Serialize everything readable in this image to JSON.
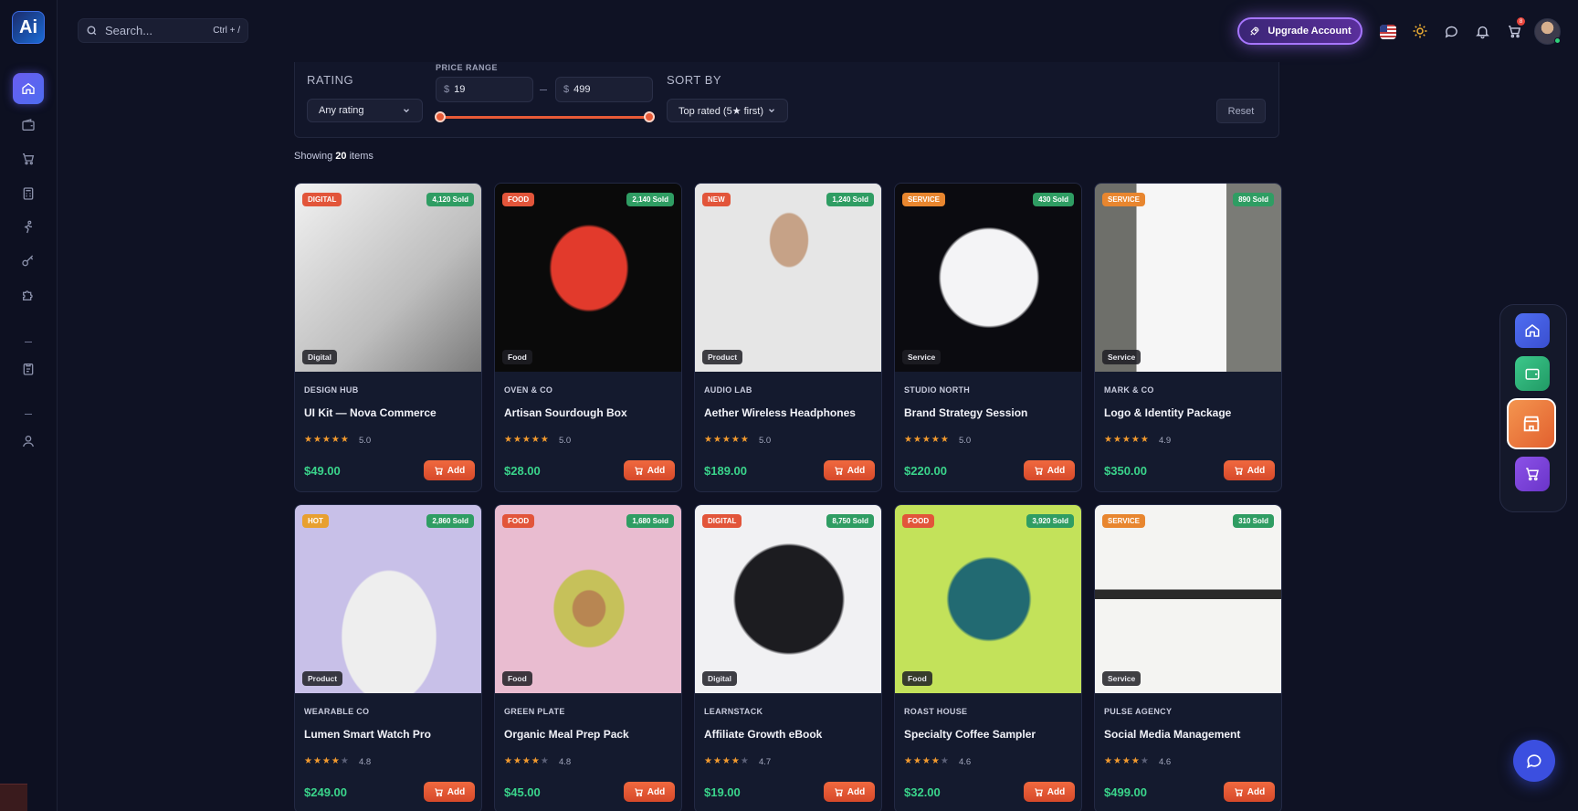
{
  "app": {
    "logo_text": "Ai"
  },
  "search": {
    "placeholder": "Search...",
    "shortcut": "Ctrl + /"
  },
  "header": {
    "upgrade_label": "Upgrade Account",
    "cart_count": "8"
  },
  "filters": {
    "rating_label": "RATING",
    "rating_value": "Any rating",
    "price_label": "PRICE RANGE",
    "currency": "$",
    "price_min": "19",
    "price_max": "499",
    "sort_label": "SORT BY",
    "sort_value": "Top rated (5★ first)",
    "reset_label": "Reset"
  },
  "results": {
    "prefix": "Showing",
    "count": "20",
    "suffix": "items"
  },
  "add_label": "Add",
  "products": [
    {
      "badge": "DIGITAL",
      "badge_color": "#e2553a",
      "sold": "4,120 Sold",
      "category": "Digital",
      "vendor": "DESIGN HUB",
      "name": "UI Kit — Nova Commerce",
      "rating": "5.0",
      "stars": 5,
      "price": "$49.00",
      "image": "camera"
    },
    {
      "badge": "FOOD",
      "badge_color": "#e2553a",
      "sold": "2,140 Sold",
      "category": "Food",
      "vendor": "OVEN & CO",
      "name": "Artisan Sourdough Box",
      "rating": "5.0",
      "stars": 5,
      "price": "$28.00",
      "image": "red-sneakers"
    },
    {
      "badge": "NEW",
      "badge_color": "#e2553a",
      "sold": "1,240 Sold",
      "category": "Product",
      "vendor": "AUDIO LAB",
      "name": "Aether Wireless Headphones",
      "rating": "5.0",
      "stars": 5,
      "price": "$189.00",
      "image": "man-tshirt"
    },
    {
      "badge": "SERVICE",
      "badge_color": "#e8862f",
      "sold": "430 Sold",
      "category": "Service",
      "vendor": "STUDIO NORTH",
      "name": "Brand Strategy Session",
      "rating": "5.0",
      "stars": 5,
      "price": "$220.00",
      "image": "controller"
    },
    {
      "badge": "SERVICE",
      "badge_color": "#e8862f",
      "sold": "890 Sold",
      "category": "Service",
      "vendor": "MARK & CO",
      "name": "Logo & Identity Package",
      "rating": "4.9",
      "stars": 5,
      "price": "$350.00",
      "image": "phone"
    },
    {
      "badge": "HOT",
      "badge_color": "#e8a02f",
      "sold": "2,860 Sold",
      "category": "Product",
      "vendor": "WEARABLE CO",
      "name": "Lumen Smart Watch Pro",
      "rating": "4.8",
      "stars": 4,
      "price": "$249.00",
      "image": "woman-tshirt"
    },
    {
      "badge": "FOOD",
      "badge_color": "#e2553a",
      "sold": "1,680 Sold",
      "category": "Food",
      "vendor": "GREEN PLATE",
      "name": "Organic Meal Prep Pack",
      "rating": "4.8",
      "stars": 4,
      "price": "$45.00",
      "image": "avocado"
    },
    {
      "badge": "DIGITAL",
      "badge_color": "#e2553a",
      "sold": "8,750 Sold",
      "category": "Digital",
      "vendor": "LEARNSTACK",
      "name": "Affiliate Growth eBook",
      "rating": "4.7",
      "stars": 4,
      "price": "$19.00",
      "image": "black-sneakers"
    },
    {
      "badge": "FOOD",
      "badge_color": "#e2553a",
      "sold": "3,920 Sold",
      "category": "Food",
      "vendor": "ROAST HOUSE",
      "name": "Specialty Coffee Sampler",
      "rating": "4.6",
      "stars": 4,
      "price": "$32.00",
      "image": "green-sneakers"
    },
    {
      "badge": "SERVICE",
      "badge_color": "#e8862f",
      "sold": "310 Sold",
      "category": "Service",
      "vendor": "PULSE AGENCY",
      "name": "Social Media Management",
      "rating": "4.6",
      "stars": 4,
      "price": "$499.00",
      "image": "selfie-stick"
    }
  ]
}
